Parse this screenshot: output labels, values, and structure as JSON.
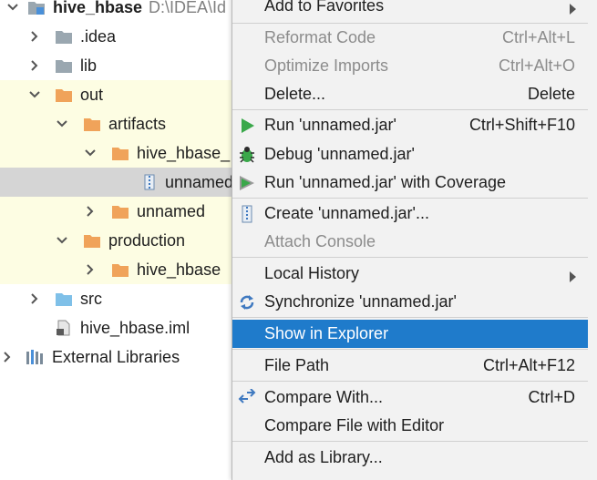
{
  "project_tree": {
    "root": {
      "label": "hive_hbase",
      "path": "D:\\IDEA\\Id"
    },
    "items": [
      {
        "label": ".idea"
      },
      {
        "label": "lib"
      },
      {
        "label": "out"
      },
      {
        "label": "artifacts"
      },
      {
        "label": "hive_hbase_"
      },
      {
        "label": "unnamed"
      },
      {
        "label": "unnamed"
      },
      {
        "label": "production"
      },
      {
        "label": "hive_hbase"
      },
      {
        "label": "src"
      },
      {
        "label": "hive_hbase.iml"
      },
      {
        "label": "External Libraries"
      }
    ]
  },
  "context_menu": {
    "items": [
      {
        "label": "Add to Favorites",
        "shortcut": ""
      },
      {
        "label": "Reformat Code",
        "shortcut": "Ctrl+Alt+L"
      },
      {
        "label": "Optimize Imports",
        "shortcut": "Ctrl+Alt+O"
      },
      {
        "label": "Delete...",
        "shortcut": "Delete"
      },
      {
        "label": "Run 'unnamed.jar'",
        "shortcut": "Ctrl+Shift+F10"
      },
      {
        "label": "Debug 'unnamed.jar'",
        "shortcut": ""
      },
      {
        "label": "Run 'unnamed.jar' with Coverage",
        "shortcut": ""
      },
      {
        "label": "Create 'unnamed.jar'...",
        "shortcut": ""
      },
      {
        "label": "Attach Console",
        "shortcut": ""
      },
      {
        "label": "Local History",
        "shortcut": ""
      },
      {
        "label": "Synchronize 'unnamed.jar'",
        "shortcut": ""
      },
      {
        "label": "Show in Explorer",
        "shortcut": ""
      },
      {
        "label": "File Path",
        "shortcut": "Ctrl+Alt+F12"
      },
      {
        "label": "Compare With...",
        "shortcut": "Ctrl+D"
      },
      {
        "label": "Compare File with Editor",
        "shortcut": ""
      },
      {
        "label": "Add as Library...",
        "shortcut": ""
      }
    ]
  },
  "colors": {
    "selection_blue": "#1f7bcb",
    "excluded_folder_yellow": "#fdfde3",
    "folder_orange": "#f0a35a",
    "run_green": "#3aa84a"
  }
}
